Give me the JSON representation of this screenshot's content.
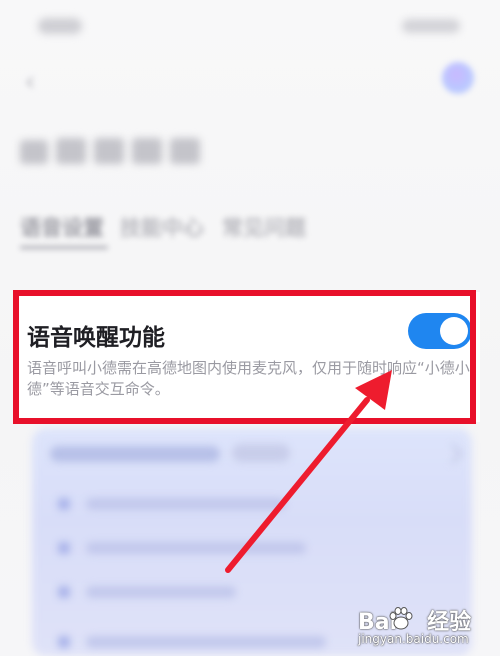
{
  "colors": {
    "toggle_on": "#1f86f0",
    "highlight": "#e8102a",
    "arrow": "#ee1c2e",
    "title_text": "#1f1f24",
    "desc_text": "#9a9aa2"
  },
  "tabs": [
    {
      "label": "语音设置",
      "active": true
    },
    {
      "label": "技能中心",
      "active": false
    },
    {
      "label": "常见问题",
      "active": false
    }
  ],
  "voice_wakeup": {
    "title": "语音唤醒功能",
    "description": "语音呼叫小德需在高德地图内使用麦克风，仅用于随时响应“小德小德”等语音交互命令。",
    "enabled": true
  },
  "icons": {
    "back": "back-arrow-icon",
    "avatar": "assistant-avatar-icon",
    "toggle": "toggle-switch-icon"
  },
  "watermark": {
    "brand_left": "Bai",
    "brand_right": "经验",
    "url": "jingyan.baidu.com"
  }
}
